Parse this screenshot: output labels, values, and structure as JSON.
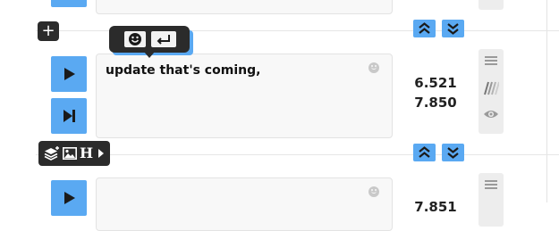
{
  "cues": [
    {
      "text": "",
      "start": "",
      "end": ""
    },
    {
      "text": "update that's coming,",
      "start": "6.521",
      "end": "7.850"
    },
    {
      "text": "",
      "start": "7.851",
      "end": ""
    }
  ],
  "toolbar_symbols": {
    "add": "+",
    "heading": "H"
  },
  "colors": {
    "accent": "#5aa9f2",
    "popup_bg": "#2b2b2b",
    "line": "#e6e6e6"
  },
  "icons": [
    "plus-icon",
    "smiley-icon",
    "enter-icon",
    "play-icon",
    "skip-to-next-icon",
    "chevrons-up-icon",
    "chevrons-down-icon",
    "menu-icon",
    "slashes-icon",
    "eye-icon",
    "layers-icon",
    "image-icon",
    "heading-icon",
    "caret-right-icon"
  ]
}
